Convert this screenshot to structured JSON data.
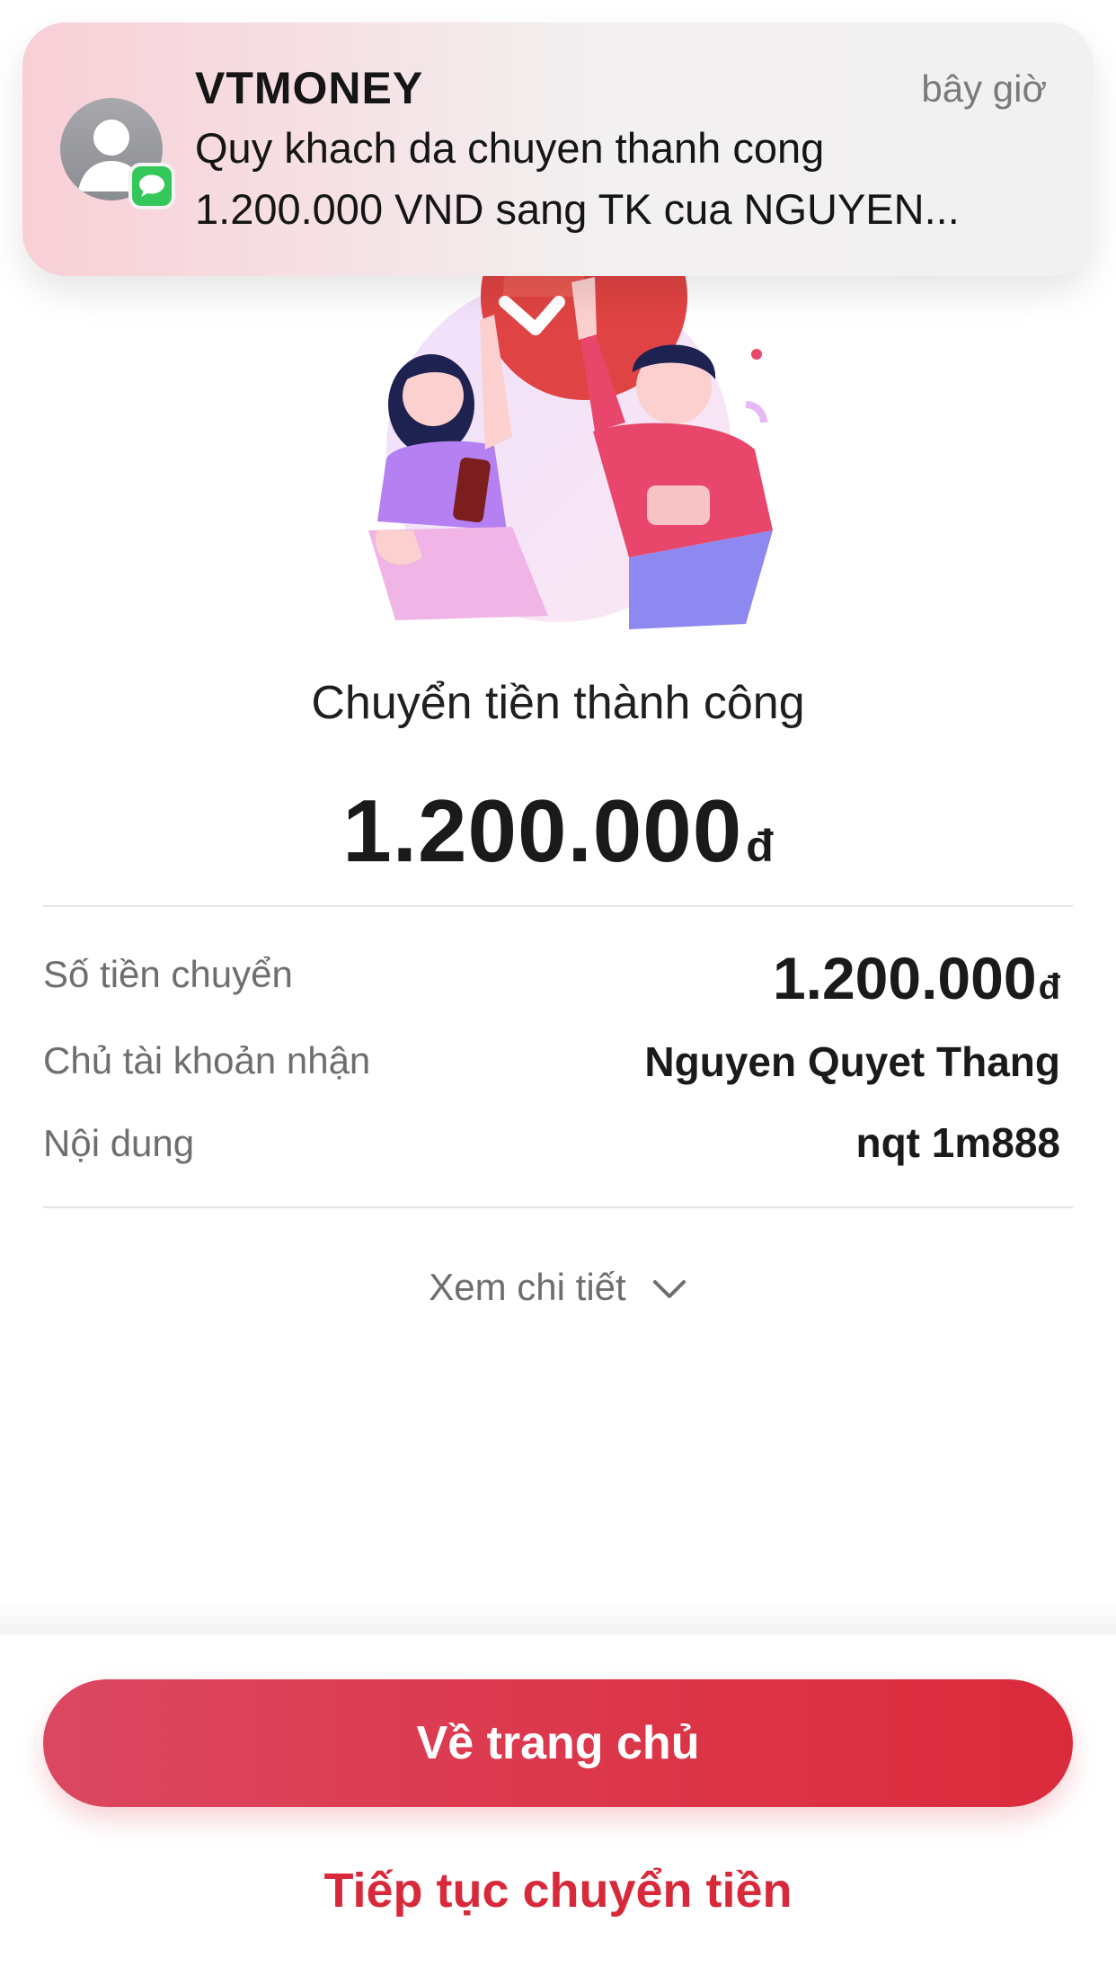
{
  "notification": {
    "app_name": "VTMONEY",
    "time": "bây giờ",
    "message_line1": "Quy khach da chuyen thanh cong",
    "message_line2": "1.200.000 VND sang TK cua NGUYEN...",
    "avatar_icon": "person-icon",
    "badge_icon": "messages-icon"
  },
  "illustration": {
    "icon": "success-celebration-illustration"
  },
  "result": {
    "title": "Chuyển tiền thành công",
    "amount": "1.200.000",
    "currency": "đ"
  },
  "details": [
    {
      "label": "Số tiền chuyển",
      "value": "1.200.000",
      "currency": "đ"
    },
    {
      "label": "Chủ tài khoản nhận",
      "value": "Nguyen Quyet Thang"
    },
    {
      "label": "Nội dung",
      "value": "nqt 1m888"
    }
  ],
  "toggle": {
    "label": "Xem chi tiết",
    "icon": "chevron-down-icon"
  },
  "actions": {
    "primary_label": "Về trang chủ",
    "secondary_label": "Tiếp tục chuyển tiền"
  },
  "colors": {
    "accent": "#dc3548",
    "accent_text": "#d8293b",
    "text_primary": "#1a1a1a",
    "text_secondary": "#6e6e6e"
  }
}
